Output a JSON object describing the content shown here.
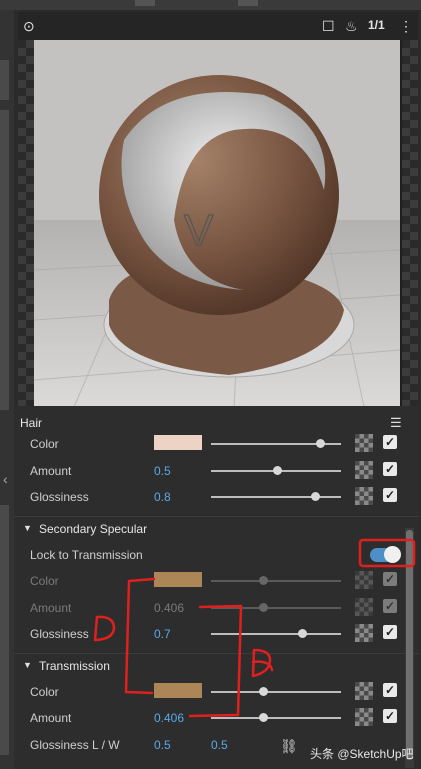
{
  "toolbar": {
    "ratio_label": "1/1",
    "icons": [
      "eye-dropper-icon",
      "region-render-icon",
      "teapot-icon",
      "more-icon"
    ]
  },
  "panel": {
    "title": "Hair",
    "hair_rows": [
      {
        "label": "Color",
        "type": "color",
        "swatch": "#ecd3c3",
        "slider": 0.85
      },
      {
        "label": "Amount",
        "value": "0.5",
        "slider": 0.5
      },
      {
        "label": "Glossiness",
        "value": "0.8",
        "slider": 0.8
      }
    ],
    "secondary_specular": {
      "title": "Secondary Specular",
      "lock_label": "Lock to Transmission",
      "lock_on": true,
      "rows": [
        {
          "label": "Color",
          "type": "color",
          "swatch": "#ad8658",
          "slider": 0.4,
          "disabled": true
        },
        {
          "label": "Amount",
          "value": "0.406",
          "slider": 0.406,
          "disabled": true
        },
        {
          "label": "Glossiness",
          "value": "0.7",
          "slider": 0.7
        }
      ]
    },
    "transmission": {
      "title": "Transmission",
      "rows": [
        {
          "label": "Color",
          "type": "color",
          "swatch": "#ad8658",
          "slider": 0.4
        },
        {
          "label": "Amount",
          "value": "0.406",
          "slider": 0.406
        }
      ],
      "glossiness_lw": {
        "label": "Glossiness L / W",
        "l": "0.5",
        "w": "0.5"
      }
    }
  },
  "annotations": {
    "handwritten_a": "a",
    "handwritten_b": "b"
  },
  "watermark": "头条 @SketchUp吧",
  "colors": {
    "accent": "#5aa9e6",
    "annotation": "#e0201e",
    "toggle": "#4e8fc7"
  }
}
